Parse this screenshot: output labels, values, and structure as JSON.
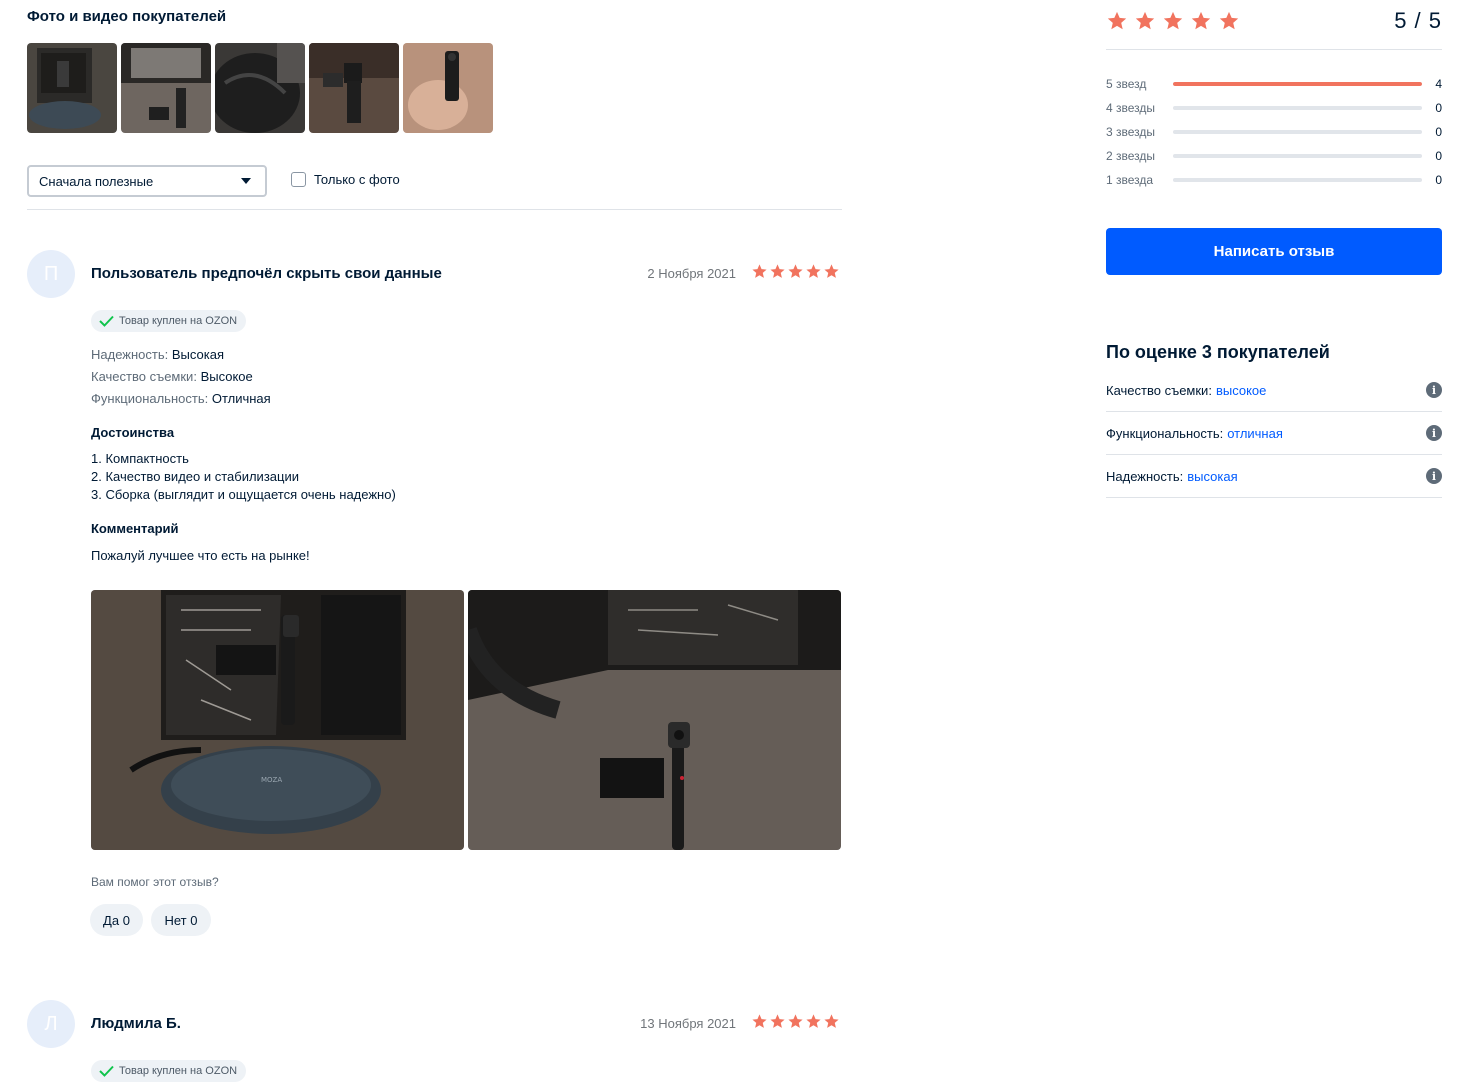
{
  "photos": {
    "title": "Фото и видео покупателей",
    "thumbnails": [
      "thumb-1",
      "thumb-2",
      "thumb-3",
      "thumb-4",
      "thumb-5"
    ]
  },
  "filters": {
    "sort_value": "Сначала полезные",
    "photo_only_label": "Только с фото"
  },
  "reviews": [
    {
      "avatar_letter": "П",
      "author": "Пользователь предпочёл скрыть свои данные",
      "date": "2 Ноября 2021",
      "rating": 5,
      "badge": "Товар куплен на OZON",
      "attributes": [
        {
          "key": "Надежность:",
          "value": "Высокая"
        },
        {
          "key": "Качество съемки:",
          "value": "Высокое"
        },
        {
          "key": "Функциональность:",
          "value": "Отличная"
        }
      ],
      "pros_title": "Достоинства",
      "pros": [
        "1. Компактность",
        "2. Качество видео и стабилизации",
        "3. Сборка (выглядит и ощущается очень надежно)"
      ],
      "comment_title": "Комментарий",
      "comment": "Пожалуй лучшее что есть на рынке!",
      "helpful_question": "Вам помог этот отзыв?",
      "yes_label": "Да 0",
      "no_label": "Нет 0"
    },
    {
      "avatar_letter": "Л",
      "author": "Людмила Б.",
      "date": "13 Ноября 2021",
      "rating": 5,
      "badge": "Товар куплен на OZON"
    }
  ],
  "summary": {
    "score": "5 / 5",
    "rating": 5,
    "distribution": [
      {
        "label": "5 звезд",
        "count": "4",
        "fraction": 1.0
      },
      {
        "label": "4 звезды",
        "count": "0",
        "fraction": 0
      },
      {
        "label": "3 звезды",
        "count": "0",
        "fraction": 0
      },
      {
        "label": "2 звезды",
        "count": "0",
        "fraction": 0
      },
      {
        "label": "1 звезда",
        "count": "0",
        "fraction": 0
      }
    ],
    "write_button": "Написать отзыв",
    "criteria_title": "По оценке 3 покупателей",
    "criteria": [
      {
        "key": "Качество съемки:",
        "value": "высокое"
      },
      {
        "key": "Функциональность:",
        "value": "отличная"
      },
      {
        "key": "Надежность:",
        "value": "высокая"
      }
    ],
    "info_glyph": "i"
  },
  "colors": {
    "star": "#f1735e",
    "accent": "#005bff",
    "link": "#005bff",
    "check": "#10c44c"
  }
}
